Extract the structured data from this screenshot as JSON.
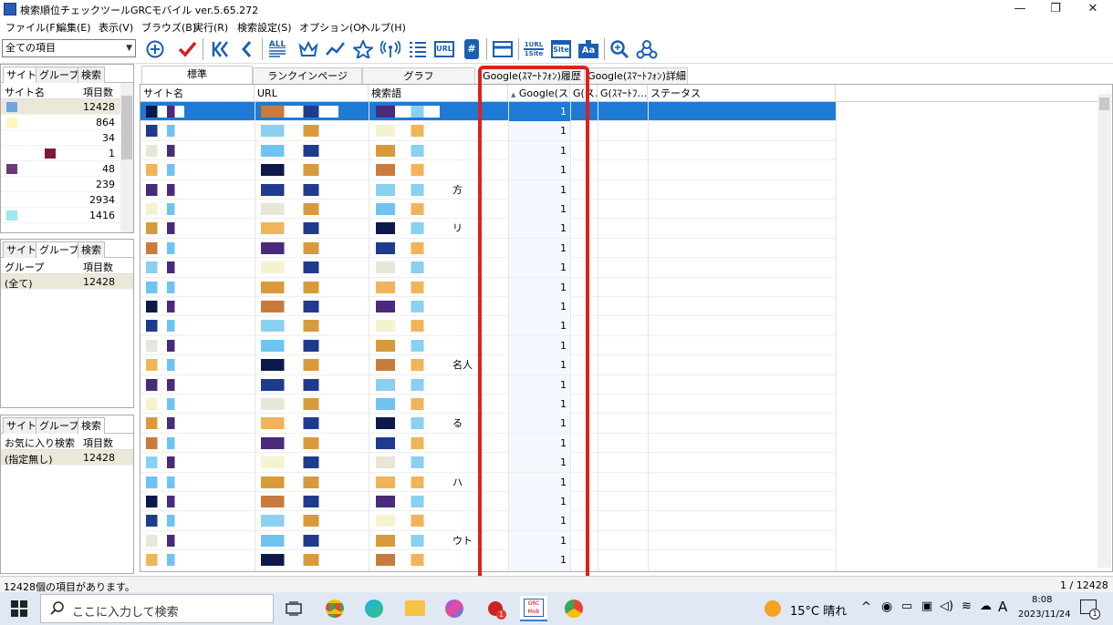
{
  "window": {
    "title": "検索順位チェックツールGRCモバイル  ver.5.65.272",
    "min": "—",
    "restore": "❐",
    "close": "✕"
  },
  "menu": [
    "ファイル(F)",
    "編集(E)",
    "表示(V)",
    "ブラウズ(B)",
    "実行(R)",
    "検索設定(S)",
    "オプション(O)",
    "ヘルプ(H)"
  ],
  "filter": {
    "value": "全ての項目"
  },
  "toolbar_icons": [
    "add-icon",
    "check-icon",
    "first-icon",
    "prev-icon",
    "all-icon",
    "crown-icon",
    "trend-icon",
    "star-icon",
    "antenna-icon",
    "list-icon",
    "url-icon",
    "hash-icon",
    "window-icon",
    "1url-1site-icon",
    "site-icon",
    "aa-icon",
    "zoom-icon",
    "network-icon"
  ],
  "toolbar_labels": {
    "all": "ALL",
    "url": "URL",
    "hash": "#",
    "url1": "1URL",
    "site1": "1Site",
    "site": "Site",
    "aa": "Aa"
  },
  "pane1": {
    "tabs": [
      "サイト",
      "グループ",
      "検索"
    ],
    "headers": [
      "サイト名",
      "項目数"
    ],
    "rows": [
      {
        "name": "",
        "count": "12428"
      },
      {
        "name": "",
        "count": "864"
      },
      {
        "name": "",
        "count": "34"
      },
      {
        "name": "",
        "count": "1"
      },
      {
        "name": "",
        "count": "48"
      },
      {
        "name": "",
        "count": "239"
      },
      {
        "name": "",
        "count": "2934"
      },
      {
        "name": "",
        "count": "1416"
      }
    ]
  },
  "pane2": {
    "tabs": [
      "サイト",
      "グループ",
      "検索"
    ],
    "headers": [
      "グループ",
      "項目数"
    ],
    "rows": [
      {
        "name": "(全て)",
        "count": "12428"
      }
    ]
  },
  "pane3": {
    "tabs": [
      "サイト",
      "グループ",
      "検索"
    ],
    "headers": [
      "お気に入り検索",
      "項目数"
    ],
    "rows": [
      {
        "name": "(指定無し)",
        "count": "12428"
      }
    ]
  },
  "main_tabs": [
    "標準",
    "ランクインページ",
    "グラフ",
    "Google(ｽﾏｰﾄﾌｫﾝ)履歴",
    "Google(ｽﾏｰﾄﾌｫﾝ)詳細"
  ],
  "grid": {
    "headers": [
      "サイト名",
      "URL",
      "検索語",
      "Google(ス…",
      "G(ス…",
      "G(ｽﾏｰﾄﾌ…",
      "ステータス"
    ],
    "sort_indicator": "▲",
    "rows": [
      {
        "kw": "",
        "rank": "1"
      },
      {
        "kw": "",
        "rank": "1"
      },
      {
        "kw": "",
        "rank": "1"
      },
      {
        "kw": "",
        "rank": "1"
      },
      {
        "kw": "方",
        "rank": "1"
      },
      {
        "kw": "",
        "rank": "1"
      },
      {
        "kw": "リ",
        "rank": "1"
      },
      {
        "kw": "",
        "rank": "1"
      },
      {
        "kw": "",
        "rank": "1"
      },
      {
        "kw": "",
        "rank": "1"
      },
      {
        "kw": "",
        "rank": "1"
      },
      {
        "kw": "",
        "rank": "1"
      },
      {
        "kw": "",
        "rank": "1"
      },
      {
        "kw": "名人",
        "rank": "1"
      },
      {
        "kw": "",
        "rank": "1"
      },
      {
        "kw": "",
        "rank": "1"
      },
      {
        "kw": "る",
        "rank": "1"
      },
      {
        "kw": "",
        "rank": "1"
      },
      {
        "kw": "",
        "rank": "1"
      },
      {
        "kw": "ハ",
        "rank": "1"
      },
      {
        "kw": "",
        "rank": "1"
      },
      {
        "kw": "",
        "rank": "1"
      },
      {
        "kw": "ウト",
        "rank": "1"
      },
      {
        "kw": "",
        "rank": "1"
      }
    ]
  },
  "status": {
    "left": "12428個の項目があります。",
    "right": "1 / 12428"
  },
  "taskbar": {
    "search_placeholder": "ここに入力して検索",
    "weather": "15°C  晴れ",
    "ime": "A",
    "time": "8:08",
    "date": "2023/11/24",
    "notify_count": "1",
    "grc_label": "GRC Mob"
  },
  "colors": {
    "selection": "#1e7ad4",
    "highlight": "#e0201e",
    "accent": "#1a5fb4"
  }
}
